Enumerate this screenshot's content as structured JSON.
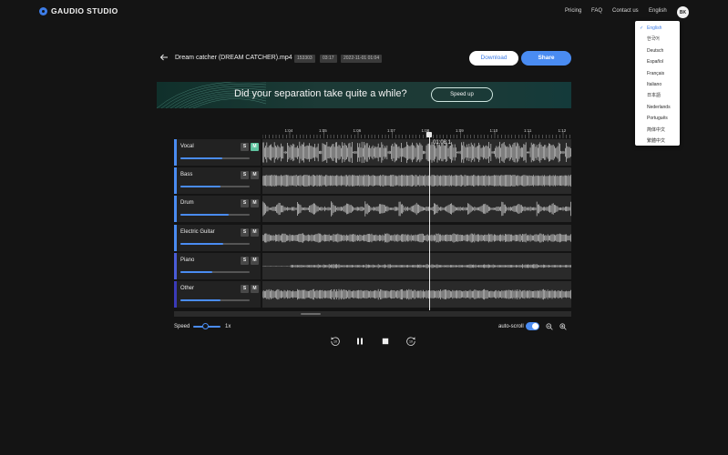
{
  "app": {
    "logo_text": "GAUDIO STUDIO",
    "nav": [
      "Pricing",
      "FAQ",
      "Contact us",
      "English"
    ],
    "avatar_initials": "BK"
  },
  "language_menu": {
    "selected": "English",
    "items": [
      "English",
      "한국어",
      "Deutsch",
      "Español",
      "Français",
      "Italiano",
      "日本語",
      "Nederlands",
      "Português",
      "简体中文",
      "繁體中文"
    ]
  },
  "file": {
    "title": "Dream catcher (DREAM CATCHER).mp4",
    "tags": [
      "153303",
      "03:17",
      "2022-11-01 01:04"
    ],
    "download_label": "Download",
    "share_label": "Share"
  },
  "banner": {
    "text": "Did your separation take quite a while?",
    "button_label": "Speed up"
  },
  "timeline": {
    "ticks": [
      "1:04",
      "1:05",
      "1:06",
      "1:07",
      "1:08",
      "1:09",
      "1:10",
      "1:11",
      "1:12"
    ],
    "playhead_time": "01:08.1"
  },
  "tracks": [
    {
      "name": "Vocal",
      "solo_label": "S",
      "mute_label": "M",
      "muted": true,
      "volume": 0.6,
      "accent": "#4a8cf2"
    },
    {
      "name": "Bass",
      "solo_label": "S",
      "mute_label": "M",
      "muted": false,
      "volume": 0.58,
      "accent": "#4a8cf2"
    },
    {
      "name": "Drum",
      "solo_label": "S",
      "mute_label": "M",
      "muted": false,
      "volume": 0.7,
      "accent": "#4a8cf2"
    },
    {
      "name": "Electric Guitar",
      "solo_label": "S",
      "mute_label": "M",
      "muted": false,
      "volume": 0.62,
      "accent": "#4a8cf2"
    },
    {
      "name": "Piano",
      "solo_label": "S",
      "mute_label": "M",
      "muted": false,
      "volume": 0.46,
      "accent": "#4a5cd8"
    },
    {
      "name": "Other",
      "solo_label": "S",
      "mute_label": "M",
      "muted": false,
      "volume": 0.58,
      "accent": "#3a3ab8"
    }
  ],
  "controls": {
    "speed_label": "Speed",
    "speed_value": "1x",
    "autoscroll_label": "auto-scroll",
    "autoscroll_on": true,
    "transport_icons": [
      "rewind-10-icon",
      "pause-icon",
      "stop-icon",
      "forward-10-icon"
    ]
  }
}
